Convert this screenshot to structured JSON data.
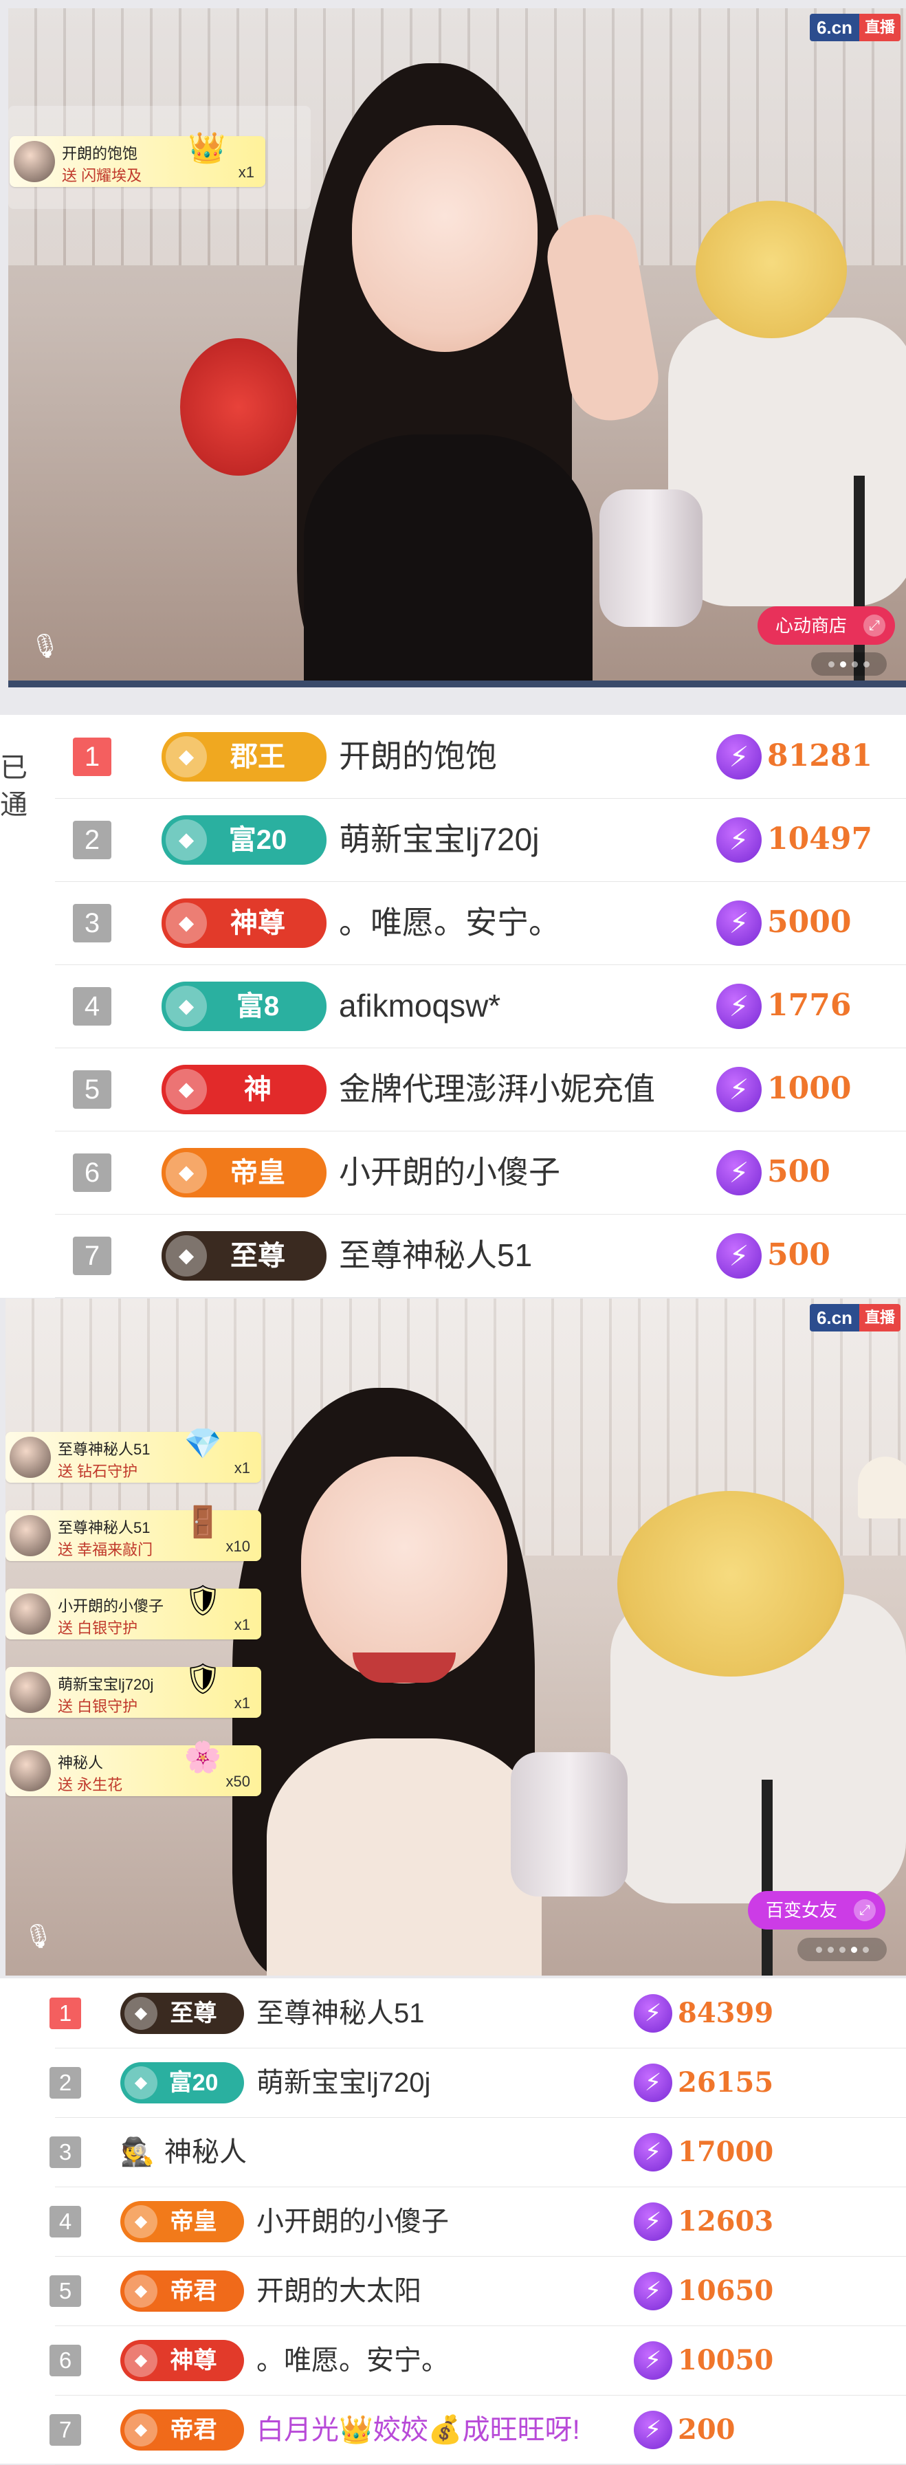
{
  "top_panel": {
    "logo_text": "6.cn",
    "logo_live": "直播",
    "gift_notice": {
      "user": "开朗的饱饱",
      "gift": "送 闪耀埃及",
      "count": "x1",
      "icon": "crown-gift-icon"
    },
    "shop_button": "心动商店",
    "carousel_dots": 4,
    "carousel_active": 2,
    "left_edge_text": [
      "已",
      "通"
    ]
  },
  "ranking_1": {
    "rows": [
      {
        "rank": "1",
        "badge": "郡王",
        "badge_color": "#f0a820",
        "user": "开朗的饱饱",
        "score": "81281"
      },
      {
        "rank": "2",
        "badge": "富20",
        "badge_color": "#2ab0a0",
        "user": "萌新宝宝lj720j",
        "score": "10497"
      },
      {
        "rank": "3",
        "badge": "神尊",
        "badge_color": "#e23a2a",
        "user": "。唯愿。安宁。",
        "score": "5000"
      },
      {
        "rank": "4",
        "badge": "富8",
        "badge_color": "#2ab0a0",
        "user": "afikmoqsw*",
        "score": "1776"
      },
      {
        "rank": "5",
        "badge": "神",
        "badge_color": "#e22a2a",
        "user": "金牌代理澎湃小妮充值",
        "score": "1000"
      },
      {
        "rank": "6",
        "badge": "帝皇",
        "badge_color": "#f27a1a",
        "user": "小开朗的小傻子",
        "score": "500"
      },
      {
        "rank": "7",
        "badge": "至尊",
        "badge_color": "#3a2a20",
        "user": "至尊神秘人51",
        "score": "500"
      }
    ]
  },
  "bottom_panel": {
    "logo_text": "6.cn",
    "logo_live": "直播",
    "gift_notices": [
      {
        "user": "至尊神秘人51",
        "gift": "送 钻石守护",
        "count": "x1",
        "icon": "diamond-guard-icon"
      },
      {
        "user": "至尊神秘人51",
        "gift": "送 幸福来敲门",
        "count": "x10",
        "icon": "door-gift-icon"
      },
      {
        "user": "小开朗的小傻子",
        "gift": "送 白银守护",
        "count": "x1",
        "icon": "silver-guard-icon"
      },
      {
        "user": "萌新宝宝lj720j",
        "gift": "送 白银守护",
        "count": "x1",
        "icon": "silver-guard-icon"
      },
      {
        "user": "神秘人",
        "gift": "送 永生花",
        "count": "x50",
        "icon": "flower-gift-icon"
      }
    ],
    "shop_button": "百变女友",
    "carousel_dots": 5,
    "carousel_active": 4
  },
  "ranking_2": {
    "rows": [
      {
        "rank": "1",
        "badge": "至尊",
        "badge_color": "#3a2a20",
        "user": "至尊神秘人51",
        "score": "84399"
      },
      {
        "rank": "2",
        "badge": "富20",
        "badge_color": "#2ab0a0",
        "user": "萌新宝宝lj720j",
        "score": "26155"
      },
      {
        "rank": "3",
        "badge": "",
        "badge_color": "",
        "user": "神秘人",
        "score": "17000"
      },
      {
        "rank": "4",
        "badge": "帝皇",
        "badge_color": "#f27a1a",
        "user": "小开朗的小傻子",
        "score": "12603"
      },
      {
        "rank": "5",
        "badge": "帝君",
        "badge_color": "#f06a1a",
        "user": "开朗的大太阳",
        "score": "10650"
      },
      {
        "rank": "6",
        "badge": "神尊",
        "badge_color": "#e23a2a",
        "user": "。唯愿。安宁。",
        "score": "10050"
      },
      {
        "rank": "7",
        "badge": "帝君",
        "badge_color": "#f06a1a",
        "user": "白月光👑姣姣💰成旺旺呀!",
        "score": "200"
      }
    ]
  }
}
